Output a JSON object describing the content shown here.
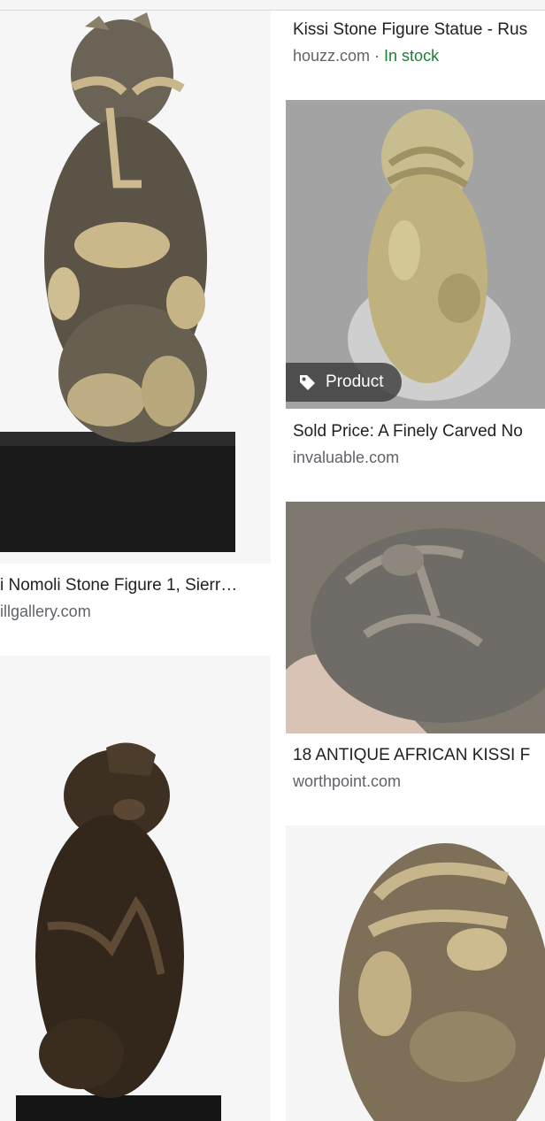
{
  "results": [
    {
      "title": "i Nomoli Stone Figure 1, Sierr…",
      "source": "illgallery.com"
    },
    {
      "title": "Kissi Stone Figure Statue - Rus",
      "source": "houzz.com",
      "separator": " · ",
      "availability": "In stock"
    },
    {
      "title": "Sold Price: A Finely Carved No",
      "source": "invaluable.com",
      "badge": {
        "label": "Product",
        "icon": "tag-icon"
      }
    },
    {
      "title": "18 ANTIQUE AFRICAN KISSI F",
      "source": "worthpoint.com"
    }
  ],
  "colors": {
    "title": "#202124",
    "source": "#5f6368",
    "in_stock": "#188038",
    "badge_bg": "#3c3c3c"
  }
}
